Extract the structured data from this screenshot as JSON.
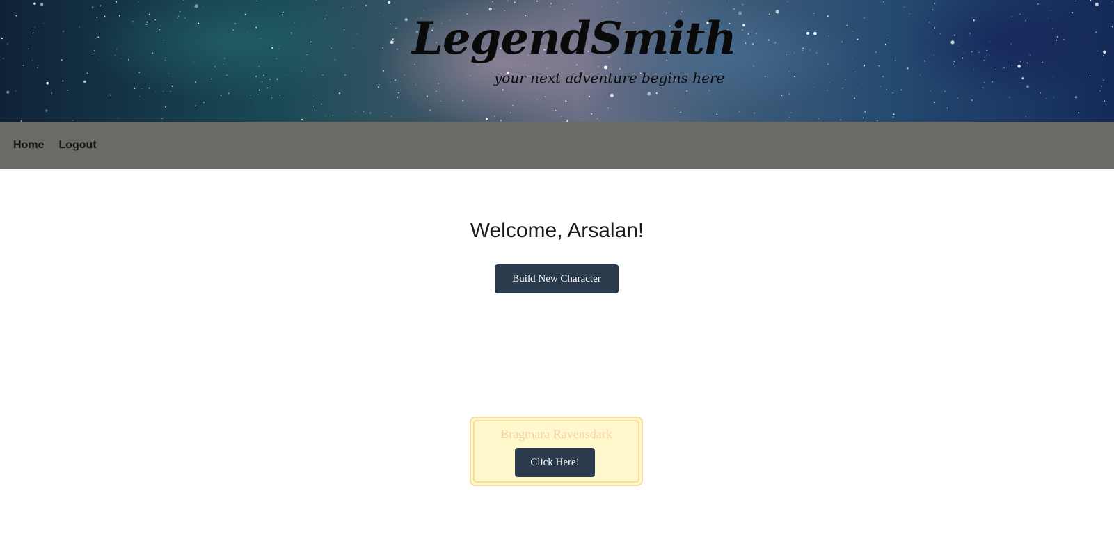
{
  "header": {
    "logo_title": "LegendSmith",
    "logo_tagline": "your next adventure begins here"
  },
  "navbar": {
    "links": [
      {
        "label": "Home"
      },
      {
        "label": "Logout"
      }
    ]
  },
  "main": {
    "welcome_text": "Welcome, Arsalan!",
    "build_button_label": "Build New Character",
    "characters": [
      {
        "name": "Bragmara Ravensdark",
        "button_label": "Click Here!"
      }
    ]
  },
  "colors": {
    "navbar_bg": "#6b6a66",
    "button_bg": "#2c3a4e",
    "card_bg": "#fff8cc",
    "card_border": "#f7dc9c",
    "card_name": "#f3d3a6"
  }
}
